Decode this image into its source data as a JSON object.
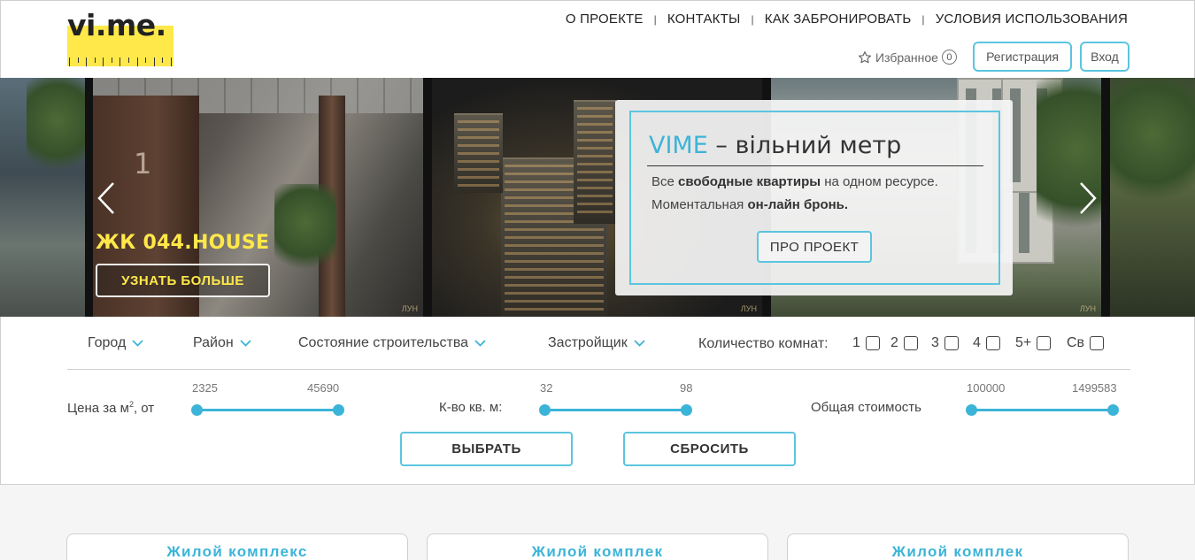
{
  "header": {
    "logo_text": "vi.me.",
    "nav": [
      "О ПРОЕКТЕ",
      "КОНТАКТЫ",
      "КАК ЗАБРОНИРОВАТЬ",
      "УСЛОВИЯ ИСПОЛЬЗОВАНИЯ"
    ],
    "favorites_label": "Избранное",
    "favorites_count": "0",
    "register_label": "Регистрация",
    "login_label": "Вход"
  },
  "slider": {
    "slide_title": "ЖК 044.HOUSE",
    "more_button": "УЗНАТЬ БОЛЬШЕ",
    "watermark": "ЛУН",
    "promo": {
      "brand": "VIME",
      "title_rest": " – вільний метр",
      "line1_pre": "Все ",
      "line1_bold": "свободные квартиры",
      "line1_post": " на одном ресурсе.",
      "line2_pre": "Моментальная ",
      "line2_bold": "он-лайн бронь.",
      "button": "ПРО ПРОЕКТ"
    }
  },
  "filters": {
    "city": "Город",
    "district": "Район",
    "construction": "Состояние строительства",
    "developer": "Застройщик",
    "rooms_label": "Количество комнат:",
    "rooms": [
      "1",
      "2",
      "3",
      "4",
      "5+",
      "Св"
    ],
    "price_label_pre": "Цена за м",
    "price_label_sup": "2",
    "price_label_post": ", от",
    "price_min": "2325",
    "price_max": "45690",
    "area_label": "К-во кв. м:",
    "area_min": "32",
    "area_max": "98",
    "total_label": "Общая стоимость",
    "total_min": "100000",
    "total_max": "1499583",
    "select_button": "ВЫБРАТЬ",
    "reset_button": "СБРОСИТЬ"
  },
  "cards": [
    "Жилой комплекс",
    "Жилой комплек",
    "Жилой комплек"
  ],
  "colors": {
    "accent": "#3cb4d8",
    "logo_yellow": "#ffe84a"
  }
}
